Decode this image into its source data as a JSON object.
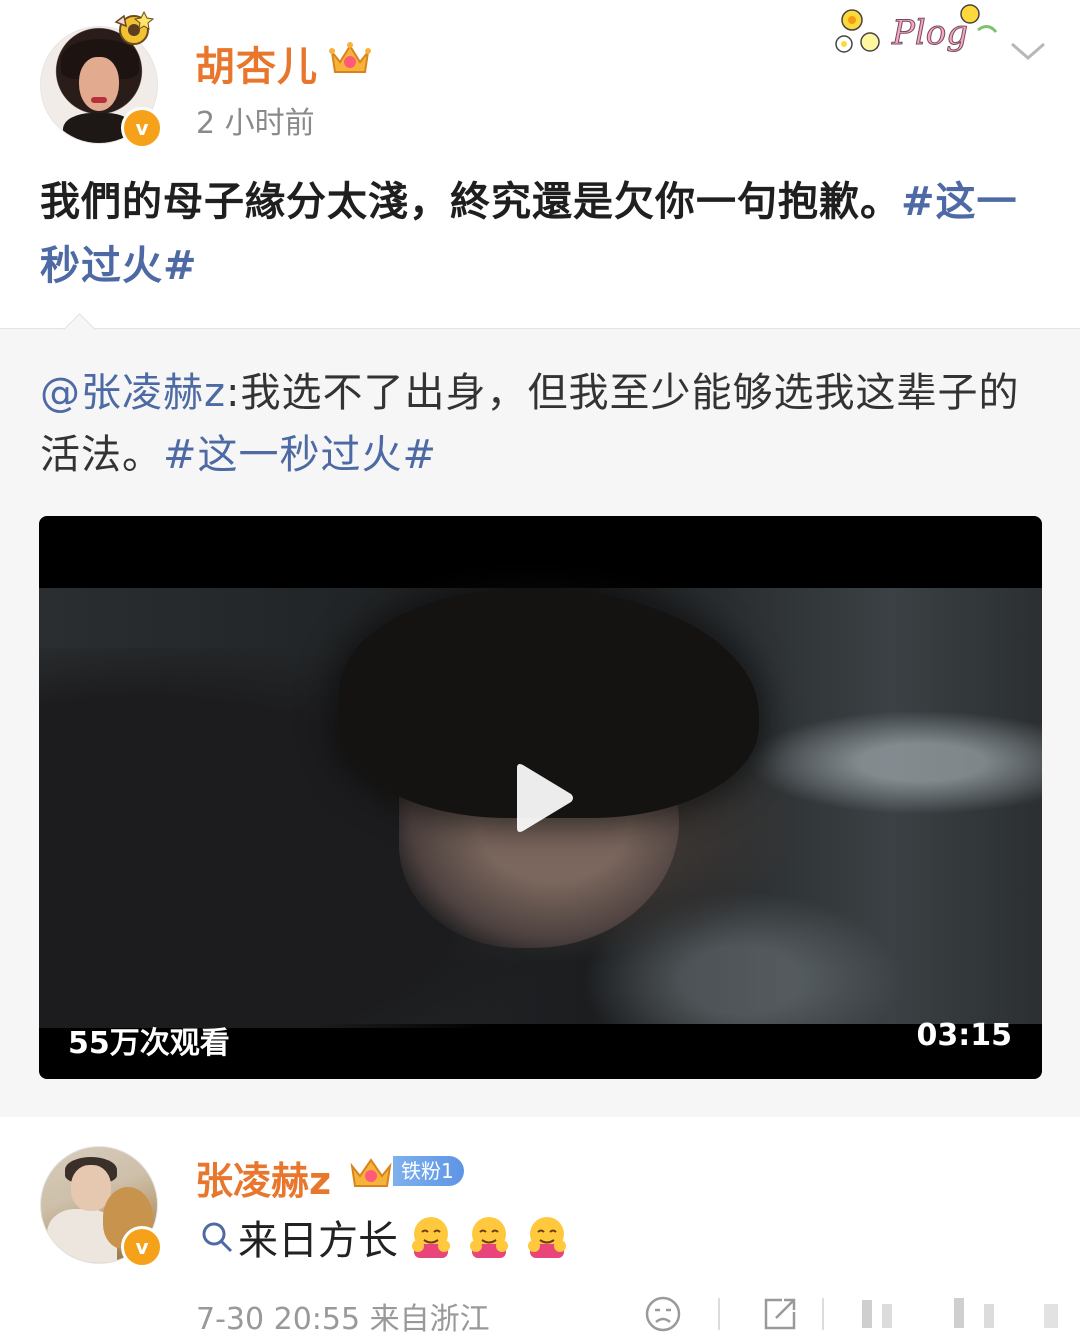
{
  "post": {
    "author_name": "胡杏儿",
    "time": "2 小时前",
    "text": "我們的母子緣分太淺，終究還是欠你一句抱歉。",
    "hashtag": "#这一秒过火#",
    "sticker_text": "Plog"
  },
  "repost": {
    "mention": "@张凌赫z",
    "text": ":我选不了出身，但我至少能够选我这辈子的活法。",
    "hashtag": "#这一秒过火#",
    "video": {
      "view_count": "55万次观看",
      "duration": "03:15"
    }
  },
  "comment": {
    "author_name": "张凌赫z",
    "fan_badge": "铁粉1",
    "text": "来日方长",
    "emoji": [
      "hug-emoji",
      "hug-emoji",
      "hug-emoji"
    ],
    "meta": "7-30  20:55  来自浙江"
  },
  "icons": {
    "verified": "v",
    "more": "chevron-down-icon",
    "play": "play-icon",
    "search": "search-icon",
    "sad_face": "sad-face-icon",
    "share": "share-icon",
    "like": "like-icon"
  },
  "colors": {
    "author_name": "#e8762c",
    "hashtag": "#4d6aa4",
    "verified": "#f5a11a",
    "repost_bg": "#f6f6f6"
  }
}
